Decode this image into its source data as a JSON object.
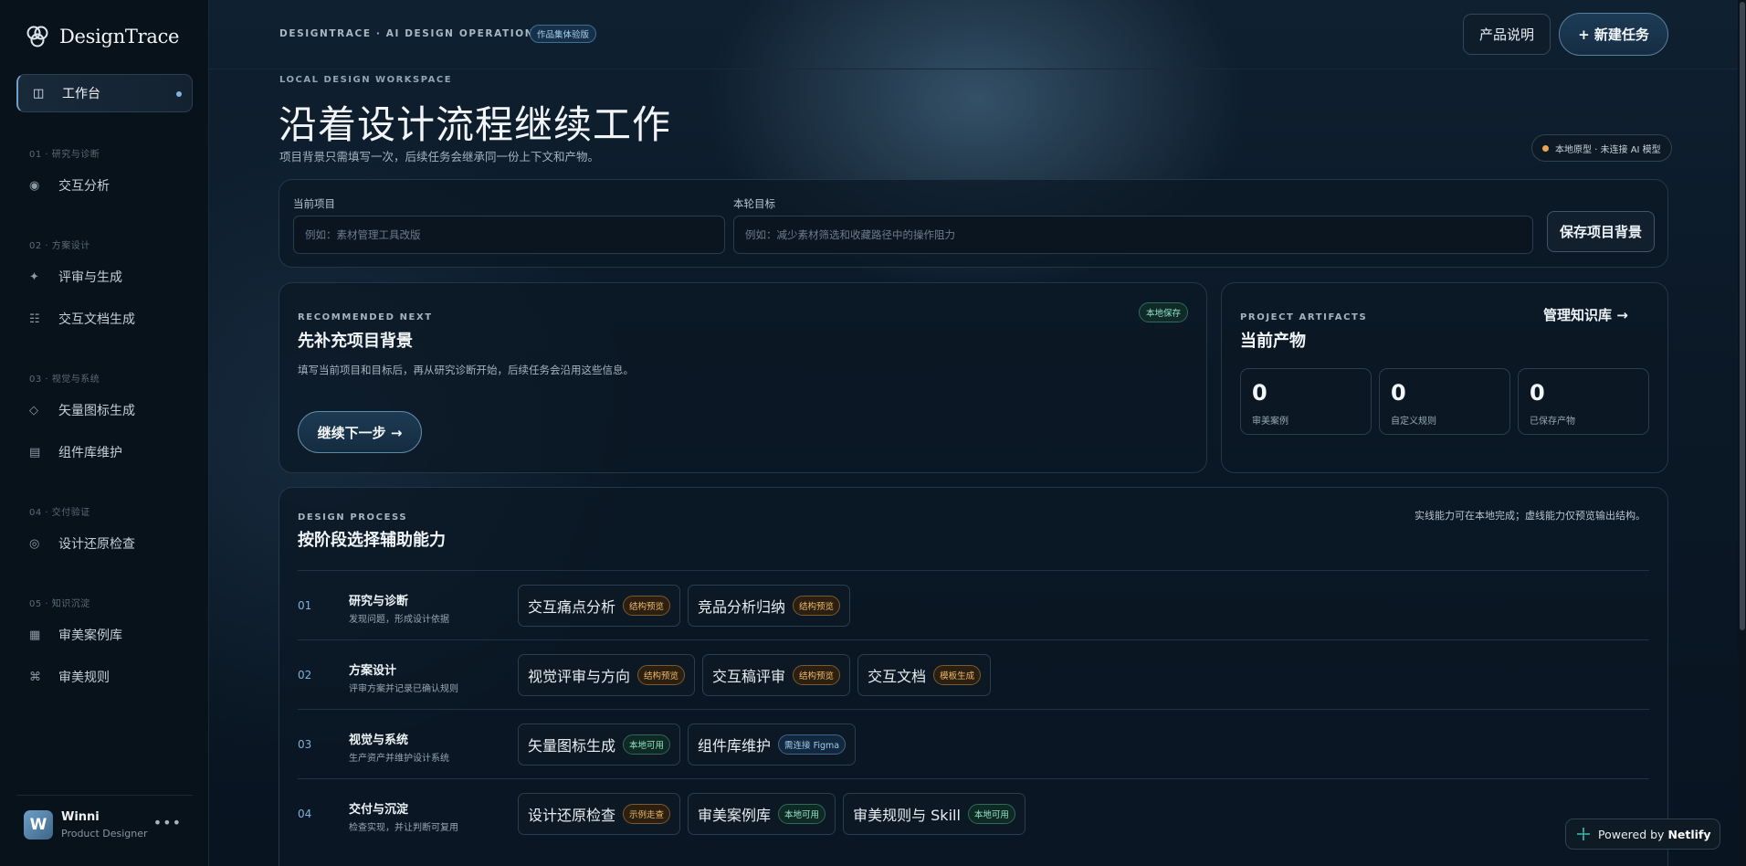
{
  "app": {
    "name": "DesignTrace"
  },
  "sidebar": {
    "active_item": {
      "label": "工作台",
      "icon": "layout-icon"
    },
    "sections": [
      {
        "title": "01 · 研究与诊断",
        "items": [
          {
            "label": "交互分析",
            "icon": "target-icon"
          }
        ]
      },
      {
        "title": "02 · 方案设计",
        "items": [
          {
            "label": "评审与生成",
            "icon": "sparkle-icon"
          },
          {
            "label": "交互文档生成",
            "icon": "list-icon"
          }
        ]
      },
      {
        "title": "03 · 视觉与系统",
        "items": [
          {
            "label": "矢量图标生成",
            "icon": "diamond-icon"
          },
          {
            "label": "组件库维护",
            "icon": "component-icon"
          }
        ]
      },
      {
        "title": "04 · 交付验证",
        "items": [
          {
            "label": "设计还原检查",
            "icon": "check-circle-icon"
          }
        ]
      },
      {
        "title": "05 · 知识沉淀",
        "items": [
          {
            "label": "审美案例库",
            "icon": "grid-icon"
          },
          {
            "label": "审美规则",
            "icon": "command-icon"
          }
        ]
      }
    ],
    "user": {
      "initial": "W",
      "name": "Winni",
      "role": "Product Designer",
      "more": "•••"
    }
  },
  "header": {
    "breadcrumb": "DESIGNTRACE · AI DESIGN OPERATIONS",
    "version_badge": "作品集体验版",
    "doc_button": "产品说明",
    "new_task_button": "+ 新建任务"
  },
  "hero": {
    "eyebrow": "LOCAL DESIGN WORKSPACE",
    "title": "沿着设计流程继续工作",
    "subtitle": "项目背景只需填写一次，后续任务会继承同一份上下文和产物。",
    "status": "本地原型 · 未连接 AI 模型"
  },
  "project_form": {
    "project_label": "当前项目",
    "project_placeholder": "例如：素材管理工具改版",
    "goal_label": "本轮目标",
    "goal_placeholder": "例如：减少素材筛选和收藏路径中的操作阻力",
    "save_button": "保存项目背景"
  },
  "recommended": {
    "kicker": "RECOMMENDED NEXT",
    "badge": "本地保存",
    "title": "先补充项目背景",
    "description": "填写当前项目和目标后，再从研究诊断开始，后续任务会沿用这些信息。",
    "button": "继续下一步 →"
  },
  "artifacts": {
    "kicker": "PROJECT ARTIFACTS",
    "title": "当前产物",
    "link": "管理知识库 →",
    "stats": [
      {
        "value": "0",
        "label": "审美案例"
      },
      {
        "value": "0",
        "label": "自定义规则"
      },
      {
        "value": "0",
        "label": "已保存产物"
      }
    ]
  },
  "process": {
    "kicker": "DESIGN PROCESS",
    "title": "按阶段选择辅助能力",
    "note": "实线能力可在本地完成；虚线能力仅预览输出结构。",
    "stages": [
      {
        "num": "01",
        "title": "研究与诊断",
        "sub": "发现问题，形成设计依据",
        "tools": [
          {
            "label": "交互痛点分析",
            "tag": "结构预览",
            "tone": "orange"
          },
          {
            "label": "竞品分析归纳",
            "tag": "结构预览",
            "tone": "orange"
          }
        ]
      },
      {
        "num": "02",
        "title": "方案设计",
        "sub": "评审方案并记录已确认规则",
        "tools": [
          {
            "label": "视觉评审与方向",
            "tag": "结构预览",
            "tone": "orange"
          },
          {
            "label": "交互稿评审",
            "tag": "结构预览",
            "tone": "orange"
          },
          {
            "label": "交互文档",
            "tag": "模板生成",
            "tone": "orange"
          }
        ]
      },
      {
        "num": "03",
        "title": "视觉与系统",
        "sub": "生产资产并维护设计系统",
        "tools": [
          {
            "label": "矢量图标生成",
            "tag": "本地可用",
            "tone": "green"
          },
          {
            "label": "组件库维护",
            "tag": "需连接 Figma",
            "tone": "blue"
          }
        ]
      },
      {
        "num": "04",
        "title": "交付与沉淀",
        "sub": "检查实现，并让判断可复用",
        "tools": [
          {
            "label": "设计还原检查",
            "tag": "示例走查",
            "tone": "orange"
          },
          {
            "label": "审美案例库",
            "tag": "本地可用",
            "tone": "green"
          },
          {
            "label": "审美规则与 Skill",
            "tag": "本地可用",
            "tone": "green"
          }
        ]
      }
    ]
  },
  "footer_badge": {
    "prefix": "Powered by",
    "brand": "Netlify"
  },
  "colors": {
    "accent": "#7eb4e0",
    "status_dot": "#e8a653",
    "tag_orange": "#f0b96a",
    "tag_green": "#8fe3c2",
    "tag_blue": "#9ccbf2"
  }
}
